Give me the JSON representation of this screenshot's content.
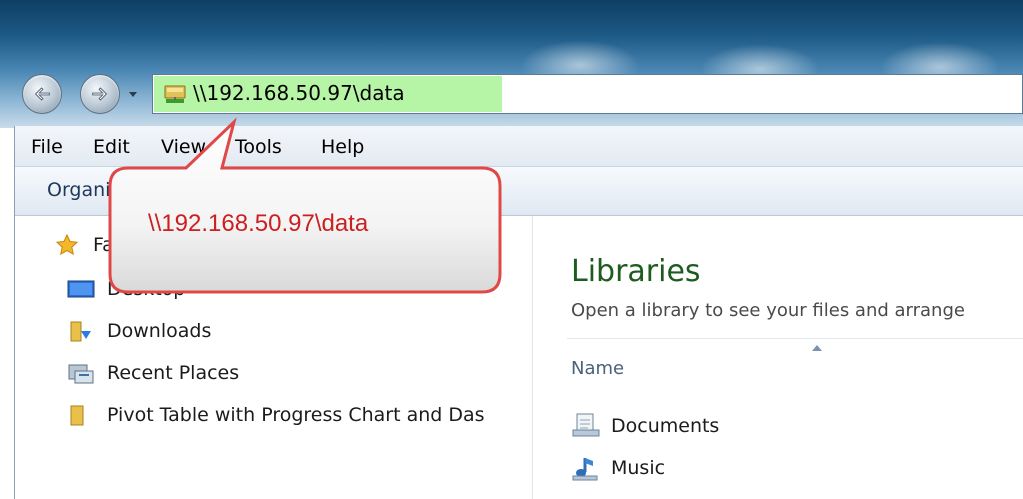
{
  "address": {
    "path": "\\\\192.168.50.97\\data"
  },
  "menu": {
    "file": "File",
    "edit": "Edit",
    "view": "View",
    "tools": "Tools",
    "help": "Help"
  },
  "toolbar": {
    "organize": "Organize"
  },
  "nav": {
    "favorites": "Favorites",
    "items": [
      {
        "label": "Desktop",
        "icon": "desktop-icon"
      },
      {
        "label": "Downloads",
        "icon": "downloads-folder-icon"
      },
      {
        "label": "Recent Places",
        "icon": "recent-places-icon"
      },
      {
        "label": "Pivot Table with Progress Chart and Das",
        "icon": "folder-icon"
      }
    ]
  },
  "content": {
    "title": "Libraries",
    "subtitle": "Open a library to see your files and arrange",
    "column_name": "Name",
    "items": [
      {
        "label": "Documents",
        "icon": "documents-library-icon"
      },
      {
        "label": "Music",
        "icon": "music-library-icon"
      }
    ]
  },
  "callout": {
    "text": "\\\\192.168.50.97\\data",
    "color": "#cc1f1f"
  },
  "colors": {
    "address_highlight": "#b7f5a6",
    "libraries_title": "#1e5b1e"
  }
}
